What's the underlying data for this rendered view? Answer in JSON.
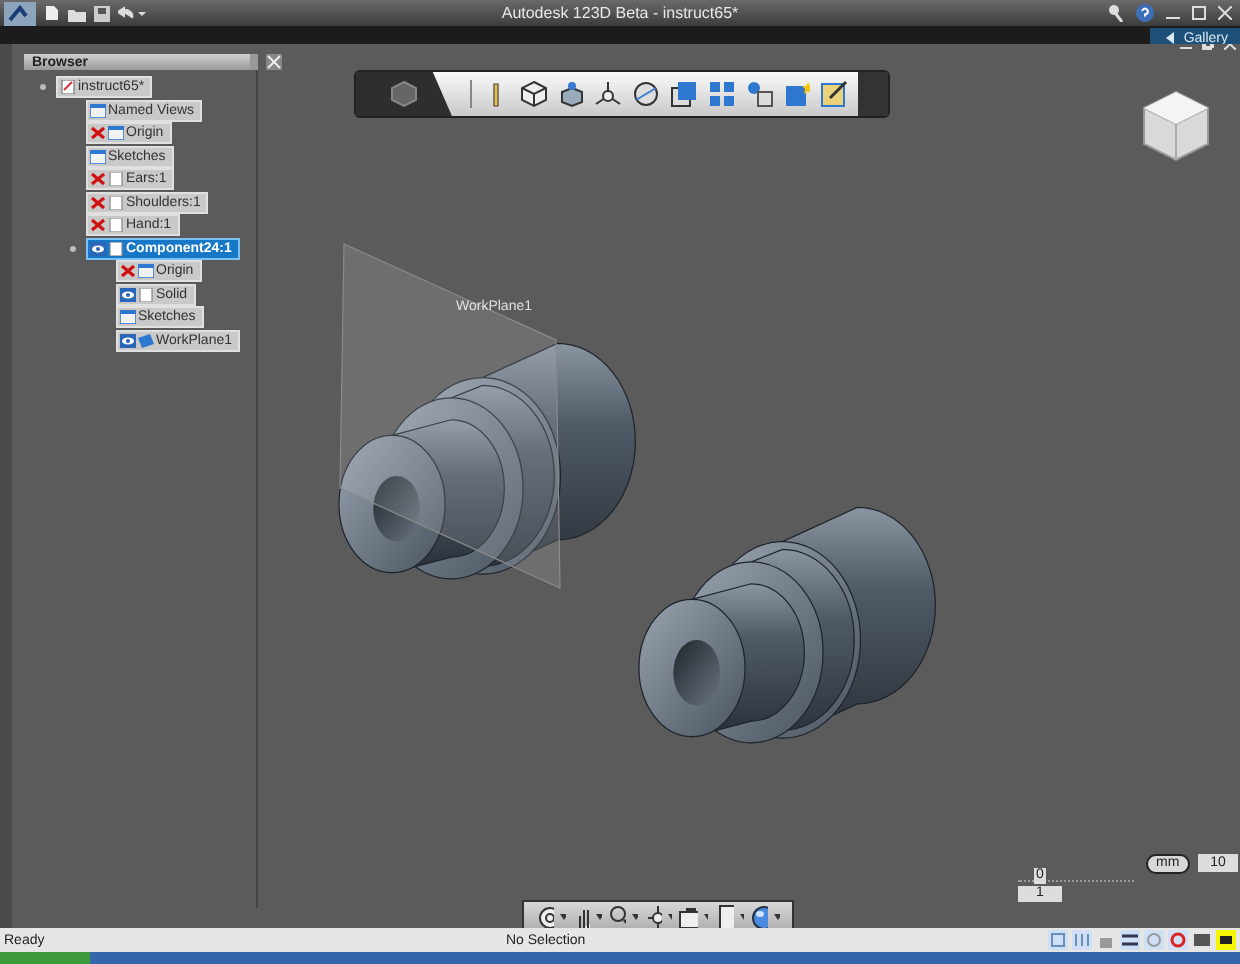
{
  "window": {
    "title": "Autodesk 123D Beta - instruct65*"
  },
  "ribbon": {
    "gallery_tab": "Gallery"
  },
  "browser": {
    "title": "Browser",
    "tree": [
      {
        "label": "instruct65*",
        "selected": false,
        "kind": "document",
        "children": [
          {
            "label": "Named Views",
            "selected": false,
            "kind": "folder"
          },
          {
            "label": "Origin",
            "selected": false,
            "kind": "folder",
            "visible": false
          },
          {
            "label": "Sketches",
            "selected": false,
            "kind": "folder"
          },
          {
            "label": "Ears:1",
            "selected": false,
            "kind": "part",
            "visible": false
          },
          {
            "label": "Shoulders:1",
            "selected": false,
            "kind": "part",
            "visible": false
          },
          {
            "label": "Hand:1",
            "selected": false,
            "kind": "part",
            "visible": false
          },
          {
            "label": "Component24:1",
            "selected": true,
            "kind": "part",
            "visible": true,
            "children": [
              {
                "label": "Origin",
                "selected": false,
                "kind": "folder",
                "visible": false
              },
              {
                "label": "Solid",
                "selected": false,
                "kind": "part",
                "visible": true
              },
              {
                "label": "Sketches",
                "selected": false,
                "kind": "folder"
              },
              {
                "label": "WorkPlane1",
                "selected": false,
                "kind": "plane",
                "visible": true
              }
            ]
          }
        ]
      }
    ]
  },
  "viewport": {
    "workplane_label": "WorkPlane1"
  },
  "scale": {
    "origin": "0",
    "unit": "mm",
    "max": "10",
    "value": "1"
  },
  "status_bar": {
    "left": "Ready",
    "center": "No Selection"
  }
}
